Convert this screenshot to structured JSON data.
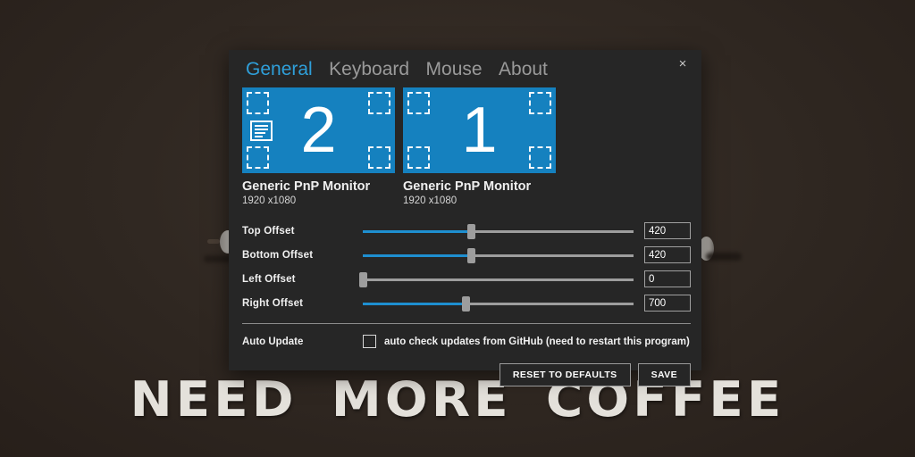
{
  "wallpaper": {
    "text": "NEED MORE COFFEE",
    "bg_color": "#2e2620"
  },
  "dialog": {
    "accent_color": "#1e8fd0",
    "bg_color": "#262626",
    "close_label": "×",
    "tabs": [
      {
        "label": "General",
        "active": true
      },
      {
        "label": "Keyboard",
        "active": false
      },
      {
        "label": "Mouse",
        "active": false
      },
      {
        "label": "About",
        "active": false
      }
    ],
    "monitors": [
      {
        "number": "2",
        "name": "Generic PnP Monitor",
        "resolution": "1920 x1080",
        "primary": true
      },
      {
        "number": "1",
        "name": "Generic PnP Monitor",
        "resolution": "1920 x1080",
        "primary": false
      }
    ],
    "sliders": [
      {
        "label": "Top Offset",
        "value": "420",
        "percent": 40
      },
      {
        "label": "Bottom Offset",
        "value": "420",
        "percent": 40
      },
      {
        "label": "Left Offset",
        "value": "0",
        "percent": 0
      },
      {
        "label": "Right Offset",
        "value": "700",
        "percent": 38
      }
    ],
    "auto_update": {
      "label": "Auto Update",
      "checkbox_text": "auto check updates from GitHub (need to restart this program)",
      "checked": false
    },
    "buttons": {
      "reset": "RESET TO DEFAULTS",
      "save": "SAVE"
    }
  }
}
